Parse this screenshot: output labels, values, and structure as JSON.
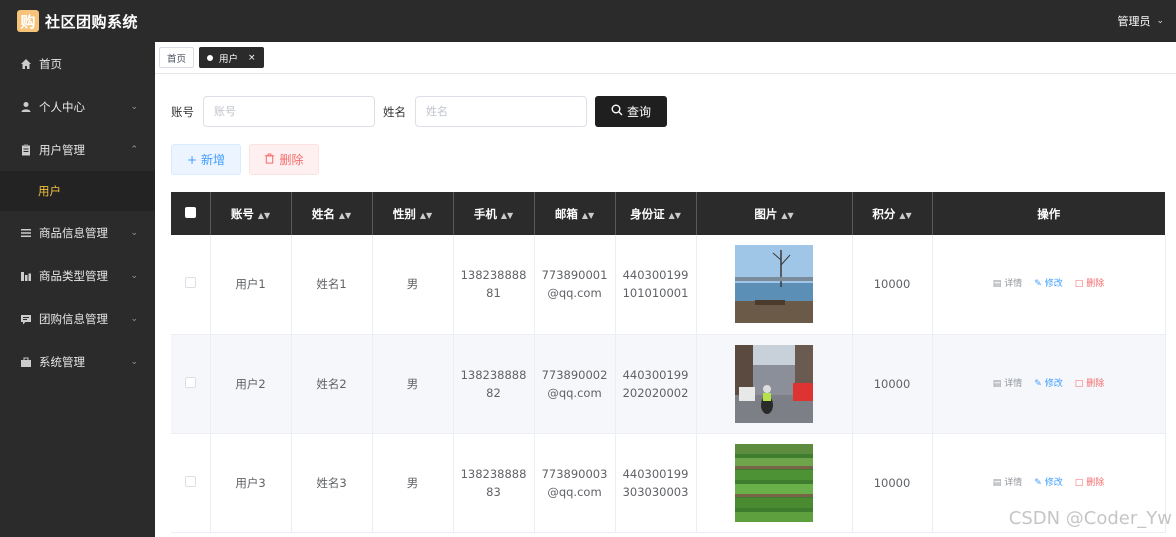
{
  "app": {
    "logo_char": "购",
    "title": "社区团购系统",
    "user": "管理员"
  },
  "sidebar": {
    "items": [
      {
        "label": "首页",
        "icon": "home-icon",
        "expandable": false
      },
      {
        "label": "个人中心",
        "icon": "person-icon",
        "expandable": true
      },
      {
        "label": "用户管理",
        "icon": "clipboard-icon",
        "expandable": true,
        "expanded": true,
        "children": [
          "用户"
        ]
      },
      {
        "label": "商品信息管理",
        "icon": "menu-icon",
        "expandable": true
      },
      {
        "label": "商品类型管理",
        "icon": "chart-icon",
        "expandable": true
      },
      {
        "label": "团购信息管理",
        "icon": "message-icon",
        "expandable": true
      },
      {
        "label": "系统管理",
        "icon": "briefcase-icon",
        "expandable": true
      }
    ],
    "active_child": "用户"
  },
  "tabs": {
    "home": "首页",
    "current": "用户"
  },
  "search": {
    "account_label": "账号",
    "account_placeholder": "账号",
    "name_label": "姓名",
    "name_placeholder": "姓名",
    "query_button": "查询"
  },
  "actions": {
    "add": "新增",
    "delete": "删除"
  },
  "table": {
    "headers": [
      "账号",
      "姓名",
      "性别",
      "手机",
      "邮箱",
      "身份证",
      "图片",
      "积分",
      "操作"
    ],
    "rows": [
      {
        "account": "用户1",
        "name": "姓名1",
        "gender": "男",
        "phone": "13823888881",
        "email": "773890001@qq.com",
        "id_card": "440300199101010001",
        "image": "lake-photo",
        "points": "10000"
      },
      {
        "account": "用户2",
        "name": "姓名2",
        "gender": "男",
        "phone": "13823888882",
        "email": "773890002@qq.com",
        "id_card": "440300199202020002",
        "image": "street-photo",
        "points": "10000"
      },
      {
        "account": "用户3",
        "name": "姓名3",
        "gender": "男",
        "phone": "13823888883",
        "email": "773890003@qq.com",
        "id_card": "440300199303030003",
        "image": "field-photo",
        "points": "10000"
      }
    ],
    "ops": {
      "detail": "详情",
      "edit": "修改",
      "delete": "删除"
    }
  },
  "watermark": "CSDN @Coder_Yw",
  "colors": {
    "dark": "#2b2b2b",
    "active_menu": "#f0c040",
    "primary": "#409eff",
    "danger": "#f56c6c"
  }
}
